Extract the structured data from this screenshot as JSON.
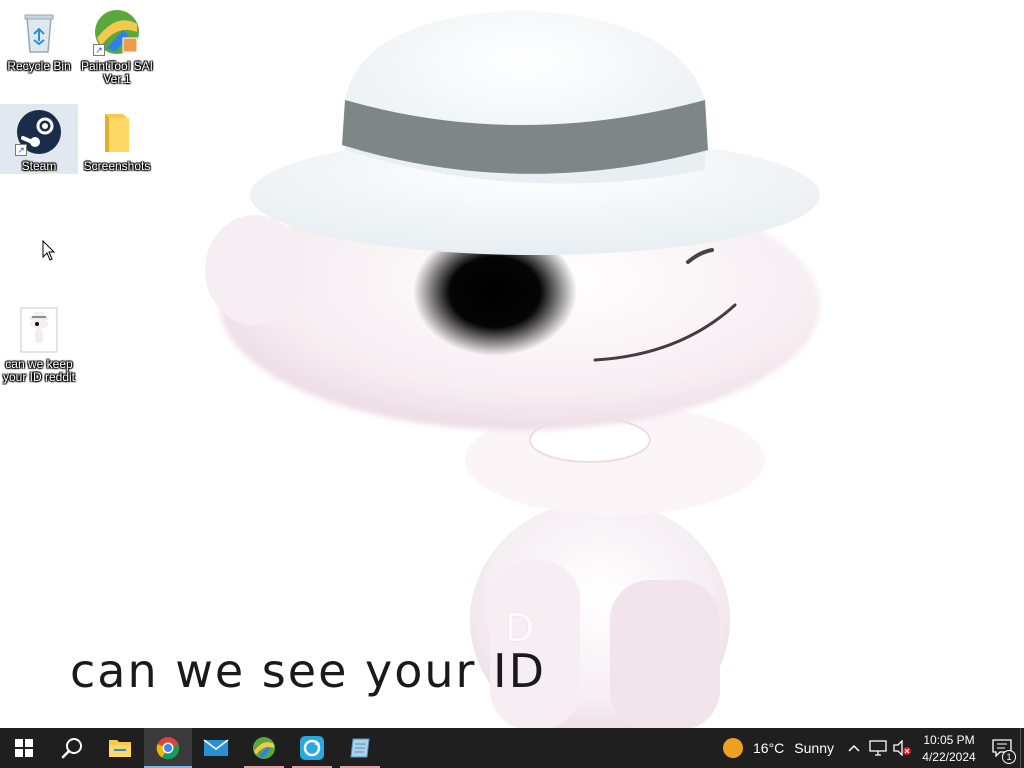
{
  "desktop": {
    "icons": [
      {
        "label": "Recycle Bin",
        "icon": "recycle-bin-icon"
      },
      {
        "label": "PaintTool SAI Ver.1",
        "icon": "painttool-sai-icon"
      },
      {
        "label": "Steam",
        "icon": "steam-icon"
      },
      {
        "label": "Screenshots",
        "icon": "folder-icon"
      },
      {
        "label": "can we keep your ID reddit",
        "icon": "image-file-icon"
      }
    ]
  },
  "wallpaper": {
    "caption": "can we see your ID",
    "ghost_text": "D"
  },
  "taskbar": {
    "apps": [
      {
        "name": "start",
        "icon": "windows-start-icon"
      },
      {
        "name": "search",
        "icon": "search-icon"
      },
      {
        "name": "file-explorer",
        "icon": "file-explorer-icon"
      },
      {
        "name": "chrome",
        "icon": "chrome-icon"
      },
      {
        "name": "mail",
        "icon": "mail-icon"
      },
      {
        "name": "painttool-sai",
        "icon": "painttool-sai-icon"
      },
      {
        "name": "sync-app",
        "icon": "sync-app-icon"
      },
      {
        "name": "notepad-app",
        "icon": "notepad-icon"
      }
    ],
    "weather": {
      "temp": "16°C",
      "condition": "Sunny"
    },
    "clock": {
      "time": "10:05 PM",
      "date": "4/22/2024"
    },
    "notification_count": "1",
    "colors": {
      "taskbar_bg": "#1f1f1f",
      "active_accent": "#76b9ed"
    }
  }
}
